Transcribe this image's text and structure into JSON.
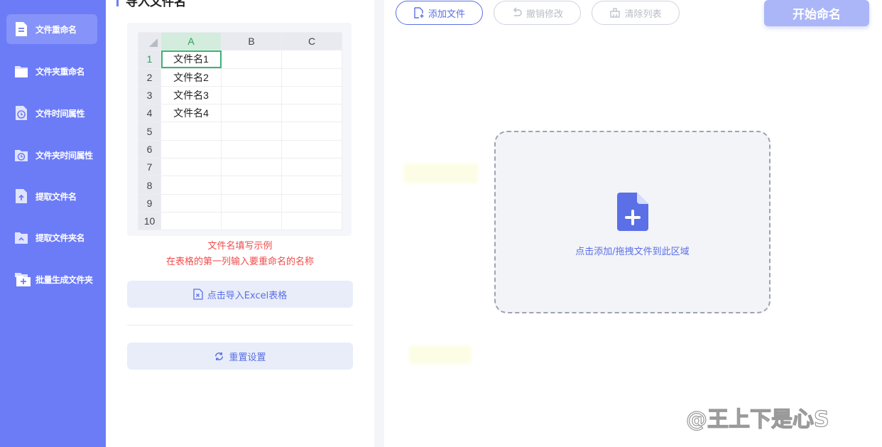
{
  "sidebar": {
    "items": [
      {
        "label": "文件重命名",
        "icon": "document-icon",
        "active": true
      },
      {
        "label": "文件夹重命名",
        "icon": "folder-icon",
        "active": false
      },
      {
        "label": "文件时间属性",
        "icon": "file-clock-icon",
        "active": false
      },
      {
        "label": "文件夹时间属性",
        "icon": "folder-clock-icon",
        "active": false
      },
      {
        "label": "提取文件名",
        "icon": "file-upload-icon",
        "active": false
      },
      {
        "label": "提取文件夹名",
        "icon": "folder-upload-icon",
        "active": false
      },
      {
        "label": "批量生成文件夹",
        "icon": "folder-plus-icon",
        "active": false
      }
    ]
  },
  "left_panel": {
    "title": "导入文件名",
    "sheet": {
      "columns": [
        "A",
        "B",
        "C"
      ],
      "rows": [
        {
          "num": "1",
          "cells": [
            "文件名1",
            "",
            ""
          ]
        },
        {
          "num": "2",
          "cells": [
            "文件名2",
            "",
            ""
          ]
        },
        {
          "num": "3",
          "cells": [
            "文件名3",
            "",
            ""
          ]
        },
        {
          "num": "4",
          "cells": [
            "文件名4",
            "",
            ""
          ]
        },
        {
          "num": "5",
          "cells": [
            "",
            "",
            ""
          ]
        },
        {
          "num": "6",
          "cells": [
            "",
            "",
            ""
          ]
        },
        {
          "num": "7",
          "cells": [
            "",
            "",
            ""
          ]
        },
        {
          "num": "8",
          "cells": [
            "",
            "",
            ""
          ]
        },
        {
          "num": "9",
          "cells": [
            "",
            "",
            ""
          ]
        },
        {
          "num": "10",
          "cells": [
            "",
            "",
            ""
          ]
        }
      ]
    },
    "hint_title": "文件名填写示例",
    "hint_desc": "在表格的第一列输入要重命名的名称",
    "import_label": "点击导入Excel表格",
    "reset_label": "重置设置"
  },
  "toolbar": {
    "add_label": "添加文件",
    "undo_label": "撤销修改",
    "clear_label": "清除列表",
    "start_label": "开始命名"
  },
  "drop_zone": {
    "text": "点击添加/拖拽文件到此区域"
  },
  "watermark": "@王上下是心S",
  "colors": {
    "sidebar": "#6c7cf7",
    "accent": "#5b6fe6",
    "hint": "#f04b4b",
    "selected_column": "#2aa05a",
    "start_button": "#aab6f7"
  }
}
